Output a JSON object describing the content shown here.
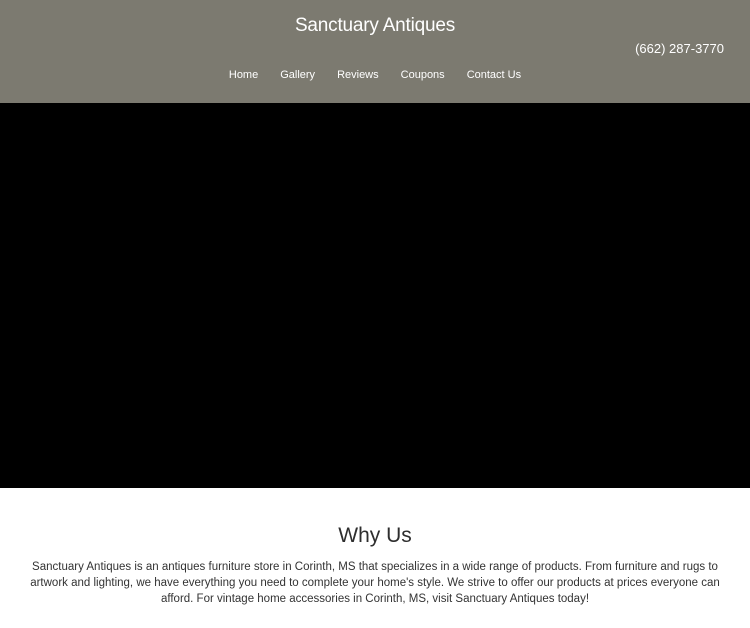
{
  "header": {
    "site_title": "Sanctuary Antiques",
    "phone": "(662) 287-3770",
    "nav": [
      {
        "label": "Home"
      },
      {
        "label": "Gallery"
      },
      {
        "label": "Reviews"
      },
      {
        "label": "Coupons"
      },
      {
        "label": "Contact Us"
      }
    ]
  },
  "why_us": {
    "heading": "Why Us",
    "body": "Sanctuary Antiques is an antiques furniture store in Corinth, MS that specializes in a wide range of products. From furniture and rugs to artwork and lighting, we have everything you need to complete your home's style. We strive to offer our products at prices everyone can afford. For vintage home accessories in Corinth, MS, visit Sanctuary Antiques today!"
  },
  "colors": {
    "header_bg": "#7c7a70",
    "hero_bg": "#000000",
    "text_dark": "#333333"
  }
}
